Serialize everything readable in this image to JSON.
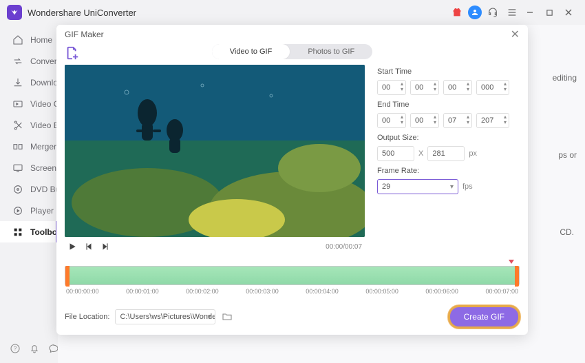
{
  "app": {
    "title": "Wondershare UniConverter"
  },
  "sidebar": {
    "items": [
      {
        "label": "Home"
      },
      {
        "label": "Converter"
      },
      {
        "label": "Downloader"
      },
      {
        "label": "Video Compressor"
      },
      {
        "label": "Video Editor"
      },
      {
        "label": "Merger"
      },
      {
        "label": "Screen Recorder"
      },
      {
        "label": "DVD Burner"
      },
      {
        "label": "Player"
      },
      {
        "label": "Toolbox"
      }
    ]
  },
  "bg": {
    "txt1": "editing",
    "txt2": "ps or",
    "txt3": "CD."
  },
  "dialog": {
    "title": "GIF Maker",
    "tabs": {
      "video": "Video to GIF",
      "photos": "Photos to GIF"
    },
    "time_readout": "00:00/00:07",
    "start_label": "Start Time",
    "end_label": "End Time",
    "start": {
      "h": "00",
      "m": "00",
      "s": "00",
      "ms": "000"
    },
    "end": {
      "h": "00",
      "m": "00",
      "s": "07",
      "ms": "207"
    },
    "output_label": "Output Size:",
    "out_w": "500",
    "out_x": "X",
    "out_h": "281",
    "px": "px",
    "rate_label": "Frame Rate:",
    "rate_value": "29",
    "fps": "fps",
    "ticks": [
      "00:00:00:00",
      "00:00:01:00",
      "00:00:02:00",
      "00:00:03:00",
      "00:00:04:00",
      "00:00:05:00",
      "00:00:06:00",
      "00:00:07:00"
    ],
    "file_label": "File Location:",
    "file_path": "C:\\Users\\ws\\Pictures\\Wondersh",
    "create": "Create GIF"
  }
}
